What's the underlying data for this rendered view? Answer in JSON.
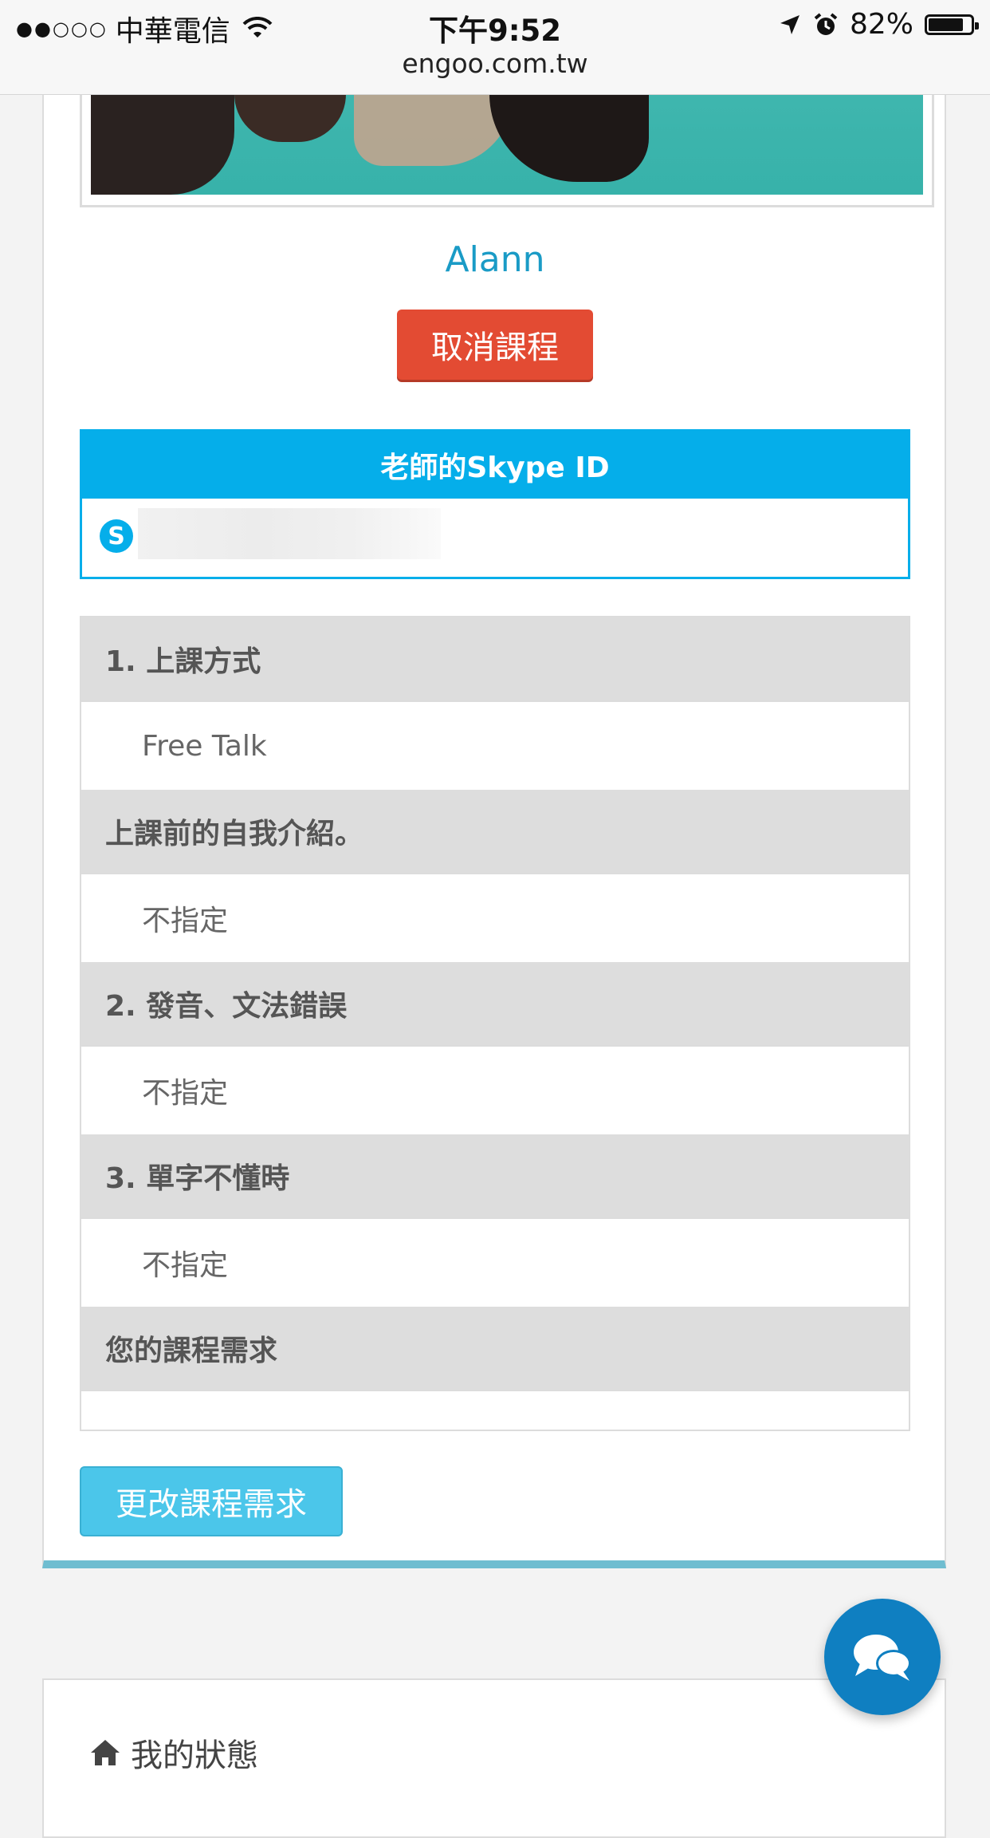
{
  "status_bar": {
    "signal": "●●○○○",
    "carrier": "中華電信",
    "time": "下午9:52",
    "battery": "82%",
    "battery_level": 0.82
  },
  "browser": {
    "url": "engoo.com.tw"
  },
  "teacher": {
    "name": "Alann"
  },
  "buttons": {
    "cancel_lesson": "取消課程",
    "change_request": "更改課程需求"
  },
  "skype": {
    "header": "老師的Skype ID",
    "icon_letter": "S",
    "id_value": ""
  },
  "questions": [
    {
      "label": "1. 上課方式",
      "answer": "Free Talk"
    },
    {
      "label": "上課前的自我介紹。",
      "answer": "不指定"
    },
    {
      "label": "2. 發音、文法錯誤",
      "answer": "不指定"
    },
    {
      "label": "3. 單字不懂時",
      "answer": "不指定"
    },
    {
      "label": "您的課程需求",
      "answer": ""
    }
  ],
  "my_status": {
    "title": "我的狀態"
  },
  "colors": {
    "accent": "#05aeea",
    "cancel": "#e34b33",
    "change": "#4bc6ea",
    "name": "#1a9bc6",
    "chat": "#0f7fc1"
  },
  "icons": {
    "wifi": "wifi-icon",
    "location": "location-arrow-icon",
    "alarm": "alarm-icon",
    "skype": "skype-icon",
    "home": "home-icon",
    "chat": "chat-bubbles-icon"
  }
}
